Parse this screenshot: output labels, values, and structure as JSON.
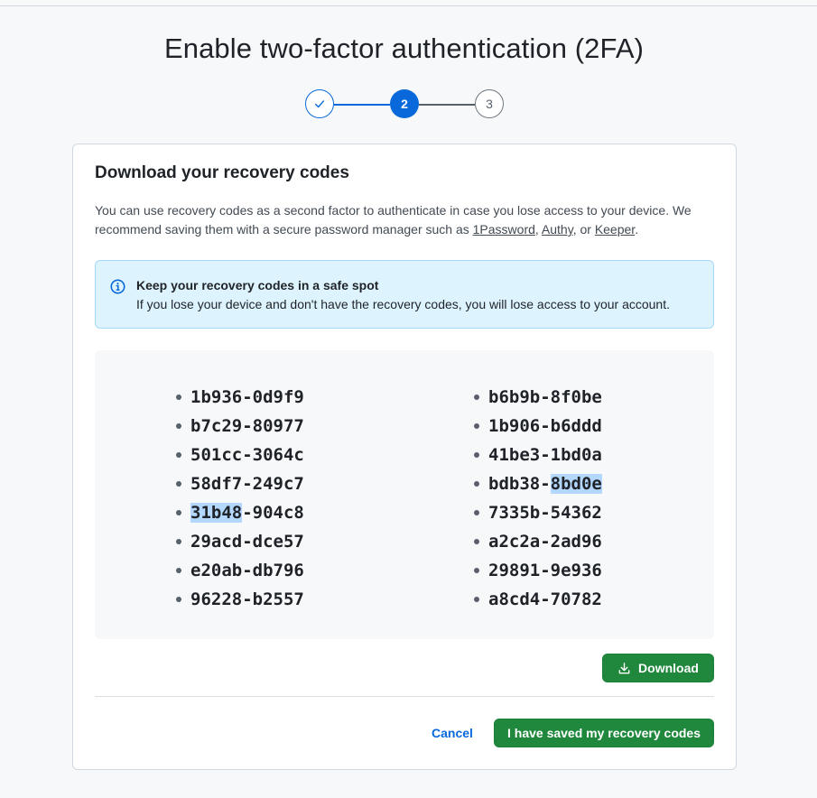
{
  "page": {
    "title": "Enable two-factor authentication (2FA)"
  },
  "stepper": {
    "step2": "2",
    "step3": "3"
  },
  "card": {
    "heading": "Download your recovery codes",
    "desc_pre": "You can use recovery codes as a second factor to authenticate in case you lose access to your device. We recommend saving them with a secure password manager such as ",
    "link_1password": "1Password",
    "sep1": ", ",
    "link_authy": "Authy",
    "sep2": ", or ",
    "link_keeper": "Keeper",
    "desc_post": ".",
    "note_title": "Keep your recovery codes in a safe spot",
    "note_body": "If you lose your device and don't have the recovery codes, you will lose access to your account."
  },
  "codes": {
    "left": [
      "1b936-0d9f9",
      "b7c29-80977",
      "501cc-3064c",
      "58df7-249c7",
      "31b48-904c8",
      "29acd-dce57",
      "e20ab-db796",
      "96228-b2557"
    ],
    "right": [
      "b6b9b-8f0be",
      "1b906-b6ddd",
      "41be3-1bd0a",
      "bdb38-8bd0e",
      "7335b-54362",
      "a2c2a-2ad96",
      "29891-9e936",
      "a8cd4-70782"
    ],
    "sel_left_4_a": "31b48",
    "sel_left_4_b": "-904c8",
    "sel_right_3_a": "bdb38-",
    "sel_right_3_b": "8bd0e"
  },
  "actions": {
    "download_label": "Download",
    "cancel_label": "Cancel",
    "saved_label": "I have saved my recovery codes"
  },
  "colors": {
    "accent": "#0969da",
    "primary_button": "#1f883d",
    "note_bg": "#ddf4ff",
    "selection": "#b3d7ff"
  }
}
